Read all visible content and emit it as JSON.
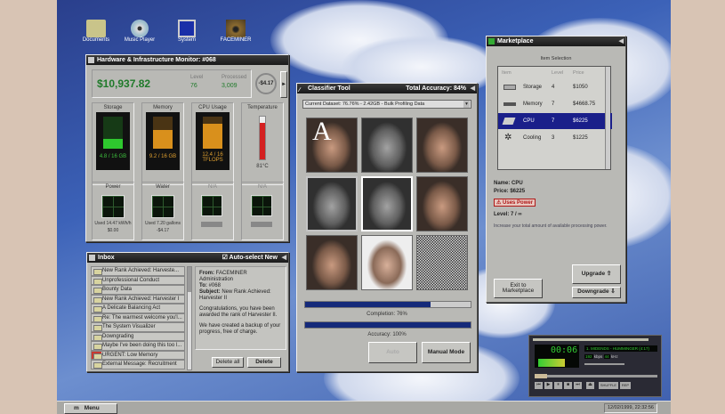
{
  "desktop": {
    "icons": [
      {
        "label": "Documents",
        "icon": "folder-icon"
      },
      {
        "label": "Music Player",
        "icon": "cd-icon"
      },
      {
        "label": "System",
        "icon": "computer-icon"
      },
      {
        "label": "FACEMINER",
        "icon": "eye-icon"
      }
    ]
  },
  "hardware": {
    "title": "Hardware & Infrastructure Monitor: #068",
    "balance": "$10,937.82",
    "level_label": "Level",
    "level": "76",
    "processed_label": "Processed",
    "processed": "3,009",
    "rate": "-$4.17",
    "storage": {
      "label": "Storage",
      "value": "4.8 / 16 GB",
      "fill": 0.3
    },
    "memory": {
      "label": "Memory",
      "value": "9.2 / 16 GB",
      "fill": 0.58
    },
    "cpu": {
      "label": "CPU Usage",
      "value": "12.4 / 16 TFLOPS",
      "fill": 0.78
    },
    "temperature": {
      "label": "Temperature",
      "value": "81°C",
      "fill": 0.85
    },
    "power": {
      "label": "Power",
      "value": "Used 14.47 kWh/h",
      "cost": "$0.00"
    },
    "water": {
      "label": "Water",
      "value": "Used 7.20 gallons",
      "cost": "-$4.17"
    },
    "na1": "N/A",
    "na2": "N/A"
  },
  "inbox": {
    "title": "Inbox",
    "auto_select": "Auto-select New",
    "items": [
      "New Rank Achieved: Harveste...",
      "Unprofessional Conduct",
      "Bounty Data",
      "New Rank Achieved: Harvester I",
      "A Delicate Balancing Act",
      "Re: The warmest welcome you'l...",
      "The System Visualizer",
      "Downgrading",
      "Maybe I've been doing this too l...",
      "URGENT: Low Memory",
      "External Message: Recruitment"
    ],
    "from_label": "From:",
    "from": "FACEMINER Administration",
    "to_label": "To:",
    "to": "#068",
    "subject_label": "Subject:",
    "subject": "New Rank Achieved: Harvester II",
    "body1": "Congratulations, you have been awarded the rank of Harvester II.",
    "body2": "We have created a backup of your progress, free of charge.",
    "delete_all": "Delete all",
    "delete": "Delete"
  },
  "classifier": {
    "title": "Classifier Tool",
    "accuracy_total": "Total Accuracy: 84%",
    "dataset": "Current Dataset: 76.76% - 2.42GB - Bulk Profiling Data",
    "completion": "Completion: 76%",
    "completion_value": 0.76,
    "accuracy": "Accuracy: 100%",
    "accuracy_value": 1.0,
    "auto_button": "Auto",
    "manual_button": "Manual Mode"
  },
  "marketplace": {
    "title": "Marketplace",
    "section": "Item Selection",
    "headers": [
      "Item",
      "Level",
      "Price"
    ],
    "items": [
      {
        "name": "Storage",
        "level": "4",
        "price": "$1050",
        "icon": "storage-icon"
      },
      {
        "name": "Memory",
        "level": "7",
        "price": "$4668.75",
        "icon": "memory-icon"
      },
      {
        "name": "CPU",
        "level": "7",
        "price": "$6225",
        "icon": "cpu-icon",
        "selected": true
      },
      {
        "name": "Cooling",
        "level": "3",
        "price": "$1225",
        "icon": "cooling-icon"
      }
    ],
    "name_line": "Name: CPU",
    "price_line": "Price: $6225",
    "warning": "⚠ Uses Power",
    "level_line": "Level: 7 / ∞",
    "description": "Increase your total amount of available processing power.",
    "exit": "Exit to Marketplace",
    "upgrade": "Upgrade ⇧",
    "downgrade": "Downgrade ⇩"
  },
  "music": {
    "time": "00:06",
    "track": "1. MIDENDS - HUMMINGER (4:17)",
    "kbps": "192",
    "khz": "44",
    "kbps_label": "kbps",
    "khz_label": "kHz",
    "shuffle": "SHUFFLE",
    "rep": "REP"
  },
  "taskbar": {
    "menu": "Menu",
    "clock": "12/02/1999, 22:32:56"
  }
}
